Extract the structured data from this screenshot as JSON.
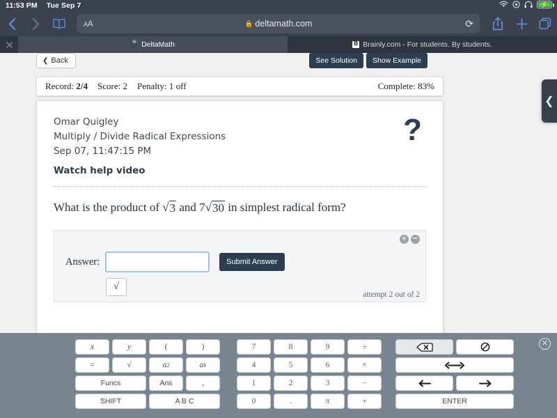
{
  "status_bar": {
    "time": "11:53 PM",
    "date": "Tue Sep 7",
    "icons": [
      "wifi-icon",
      "control-center-icon",
      "headphones-icon",
      "battery-charging-icon"
    ]
  },
  "browser": {
    "back_icon": "chevron-left-icon",
    "forward_icon": "chevron-right-icon",
    "bookmarks_icon": "book-icon",
    "text_size_label": "AA",
    "lock_icon": "lock-icon",
    "url": "deltamath.com",
    "reload_icon": "reload-icon",
    "share_icon": "share-icon",
    "new_tab_icon": "plus-icon",
    "tabs_overview_icon": "tabs-icon",
    "close_tab_icon": "close-icon",
    "tabs": [
      {
        "title": "DeltaMath",
        "active": true
      },
      {
        "title": "Brainly.com - For students. By students.",
        "active": false
      }
    ]
  },
  "page": {
    "back_button": "Back",
    "see_solution_button": "See Solution",
    "show_example_button": "Show Example",
    "status": {
      "record_label": "Record:",
      "record_value": "2/4",
      "score_label": "Score:",
      "score_value": "2",
      "penalty_label": "Penalty:",
      "penalty_value": "1 off",
      "complete_label": "Complete:",
      "complete_value": "83%"
    },
    "assignment": {
      "student_name": "Omar Quigley",
      "topic": "Multiply / Divide Radical Expressions",
      "timestamp": "Sep 07, 11:47:15 PM",
      "help_link": "Watch help video",
      "help_icon": "question-mark-icon"
    },
    "question": {
      "prefix": "What is the product of",
      "radicand_1": "3",
      "connector": "and",
      "coefficient_2": "7",
      "radicand_2": "30",
      "suffix": "in simplest radical form?"
    },
    "answer_area": {
      "label": "Answer:",
      "input_value": "",
      "input_placeholder": "",
      "submit_button": "Submit Answer",
      "sqrt_button": "√",
      "attempt_text": "attempt 2 out of 2",
      "zoom_in_icon": "zoom-in-icon",
      "zoom_out_icon": "zoom-out-icon"
    },
    "side_tab_icon": "chevron-left-icon"
  },
  "keyboard": {
    "close_icon": "close-circle-icon",
    "left_group": [
      [
        {
          "label": "x",
          "style": "italic"
        },
        {
          "label": "y",
          "style": "italic"
        },
        {
          "label": "(",
          "style": "plain"
        },
        {
          "label": ")",
          "style": "plain"
        }
      ],
      [
        {
          "label": "=",
          "style": "plain"
        },
        {
          "label": "√",
          "style": "plain"
        },
        {
          "label": "a2",
          "style": "power2"
        },
        {
          "label": "ab",
          "style": "powerb"
        }
      ],
      [
        {
          "label": "Funcs",
          "style": "wide-sans"
        },
        {
          "label": "Ans",
          "style": "sans"
        },
        {
          "label": ",",
          "style": "plain"
        }
      ],
      [
        {
          "label": "SHIFT",
          "style": "wide-sans"
        },
        {
          "label": "A B C",
          "style": "wide-sans"
        }
      ]
    ],
    "number_group": [
      [
        "7",
        "8",
        "9",
        "÷"
      ],
      [
        "4",
        "5",
        "6",
        "×"
      ],
      [
        "1",
        "2",
        "3",
        "−"
      ],
      [
        "0",
        ".",
        "π",
        "+"
      ]
    ],
    "right_group": [
      {
        "label": "⌫",
        "name": "backspace-key",
        "state": "pressed",
        "width": "half"
      },
      {
        "label": "⊘",
        "name": "clear-key",
        "state": "normal",
        "width": "half"
      },
      {
        "label": "↔",
        "name": "move-out-key",
        "state": "normal",
        "width": "full"
      },
      {
        "label": "←",
        "name": "arrow-left-key",
        "state": "normal",
        "width": "half"
      },
      {
        "label": "→",
        "name": "arrow-right-key",
        "state": "normal",
        "width": "half"
      },
      {
        "label": "ENTER",
        "name": "enter-key",
        "state": "normal",
        "width": "full"
      }
    ]
  },
  "colors": {
    "chrome_bg": "#3b424d",
    "tab_active": "#464d57",
    "accent_blue": "#5a8fdb",
    "navy_button": "#2c3e50",
    "keyboard_bg": "#78848f",
    "battery_green": "#3ad354",
    "input_border": "#9ec5e0"
  }
}
